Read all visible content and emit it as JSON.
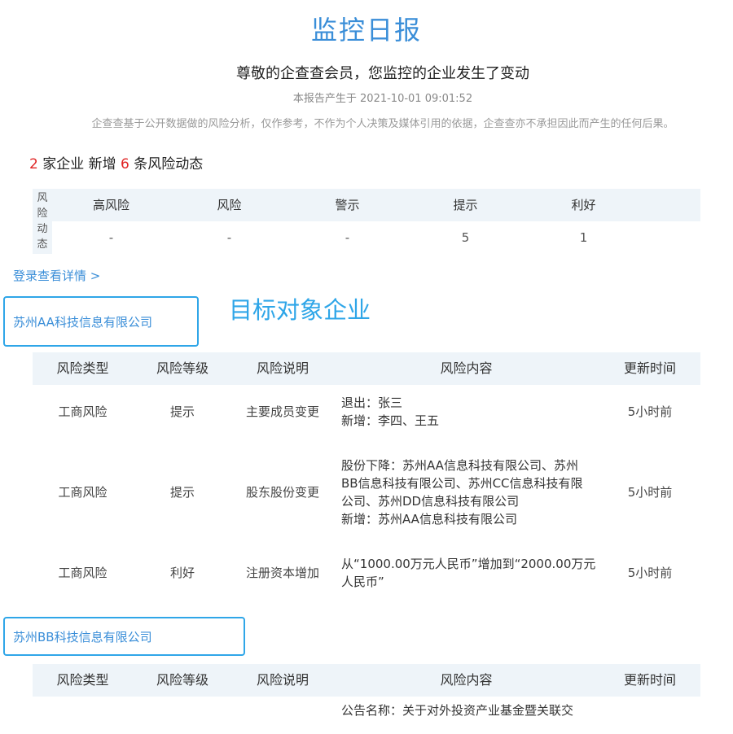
{
  "header": {
    "title": "监控日报",
    "subtitle": "尊敬的企查查会员，您监控的企业发生了变动",
    "report_time": "本报告产生于 2021-10-01 09:01:52",
    "disclaimer": "企查查基于公开数据做的风险分析，仅作参考，不作为个人决策及媒体引用的依据，企查查亦不承担因此而产生的任何后果。"
  },
  "summary": {
    "company_count": "2",
    "text1": " 家企业 新增 ",
    "risk_count": "6",
    "text2": " 条风险动态"
  },
  "risk_overview": {
    "side_label": [
      "风",
      "险",
      "动",
      "态"
    ],
    "headers": [
      "高风险",
      "风险",
      "警示",
      "提示",
      "利好"
    ],
    "values": [
      "-",
      "-",
      "-",
      "5",
      "1"
    ]
  },
  "login_link": "登录查看详情 >",
  "annotation": "目标对象企业",
  "colors": {
    "accent": "#3a8ed8",
    "box_border": "#2fa6e8",
    "highlight_red": "#e02424",
    "good_green": "#3fa33f"
  },
  "detail_headers": [
    "风险类型",
    "风险等级",
    "风险说明",
    "风险内容",
    "更新时间"
  ],
  "companies": [
    {
      "name": "苏州AA科技信息有限公司",
      "rows": [
        {
          "type": "工商风险",
          "level": "提示",
          "desc": "主要成员变更",
          "content": [
            "退出：张三",
            "新增：李四、王五"
          ],
          "time": "5小时前"
        },
        {
          "type": "工商风险",
          "level": "提示",
          "desc": "股东股份变更",
          "content": [
            "股份下降：苏州AA信息科技有限公司、苏州",
            "BB信息科技有限公司、苏州CC信息科技有限",
            "公司、苏州DD信息科技有限公司",
            "新增：苏州AA信息科技有限公司"
          ],
          "time": "5小时前"
        },
        {
          "type": "工商风险",
          "level": "利好",
          "desc": "注册资本增加",
          "content": [
            "从“1000.00万元人民币”增加到“2000.00万元",
            "人民币”"
          ],
          "time": "5小时前"
        }
      ]
    },
    {
      "name": "苏州BB科技信息有限公司",
      "rows": [
        {
          "content": [
            "公告名称：关于对外投资产业基金暨关联交"
          ]
        }
      ]
    }
  ]
}
